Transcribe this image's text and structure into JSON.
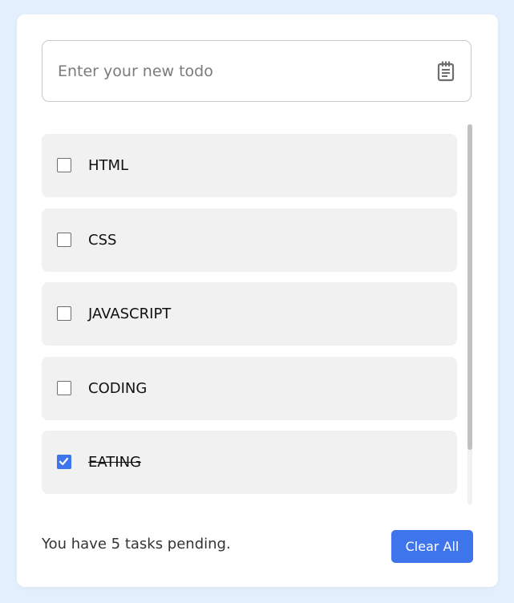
{
  "input": {
    "placeholder": "Enter your new todo",
    "value": "",
    "icon": "notepad-icon"
  },
  "todos": [
    {
      "label": "HTML",
      "checked": false
    },
    {
      "label": "CSS",
      "checked": false
    },
    {
      "label": "JAVASCRIPT",
      "checked": false
    },
    {
      "label": "CODING",
      "checked": false
    },
    {
      "label": "EATING",
      "checked": true
    }
  ],
  "footer": {
    "pending_prefix": "You have ",
    "pending_count": "5",
    "pending_suffix": " tasks pending.",
    "clear_label": "Clear All"
  },
  "colors": {
    "background": "#e3effc",
    "accent": "#3e75ec",
    "item_bg": "#f1f1f1"
  }
}
